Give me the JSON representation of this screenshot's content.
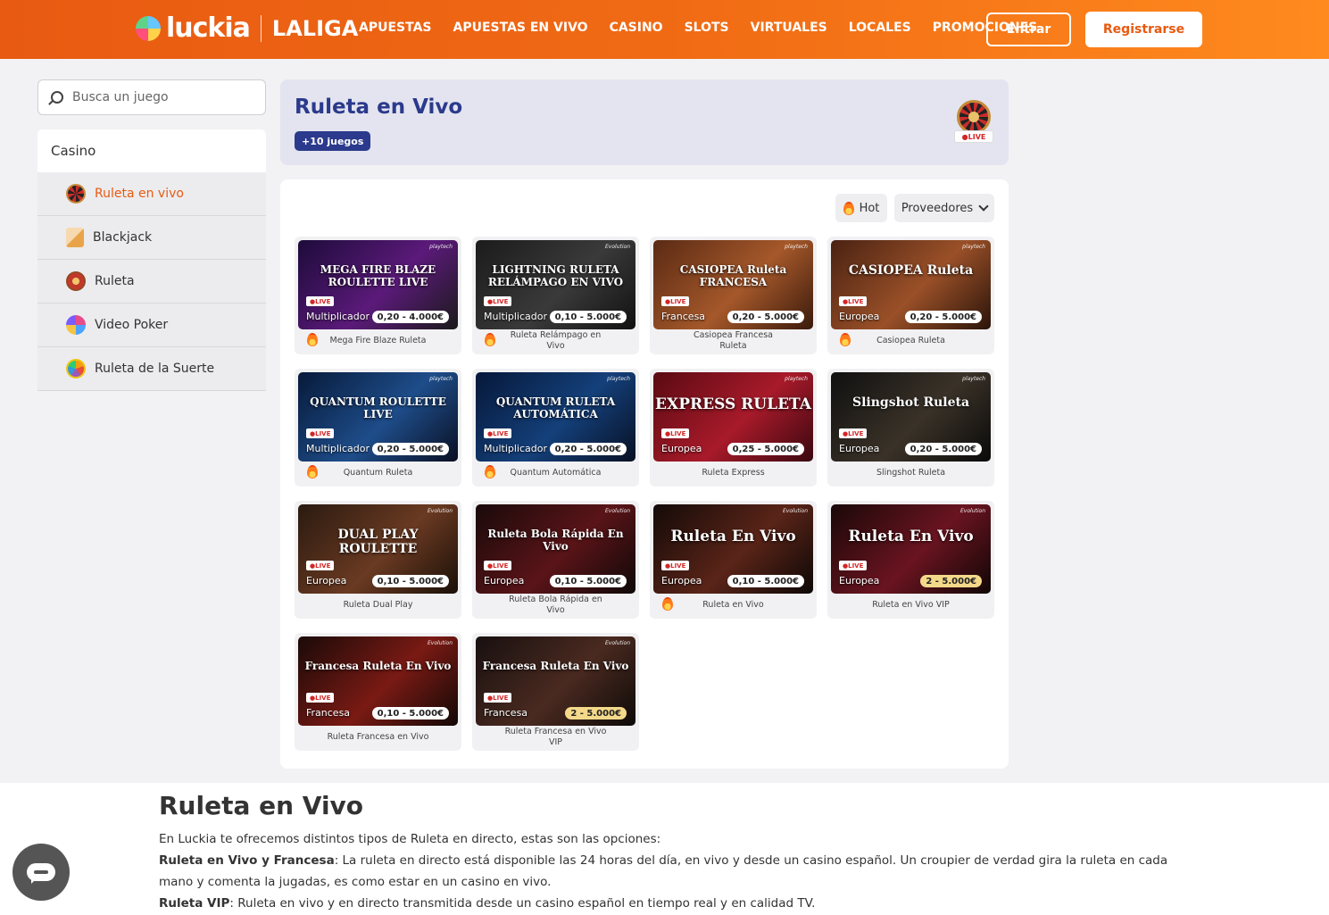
{
  "header": {
    "logo_text": "luckia",
    "logo_partner": "LALIGA",
    "nav": [
      "APUESTAS",
      "APUESTAS EN VIVO",
      "CASINO",
      "SLOTS",
      "VIRTUALES",
      "LOCALES",
      "PROMOCIONES"
    ],
    "login_label": "Entrar",
    "register_label": "Registrarse",
    "brand_color": "#e85a12"
  },
  "sidebar": {
    "search_placeholder": "Busca un juego",
    "section_title": "Casino",
    "items": [
      {
        "label": "Ruleta en vivo",
        "icon": "live-roulette-icon",
        "active": true
      },
      {
        "label": "Blackjack",
        "icon": "cards-icon",
        "active": false
      },
      {
        "label": "Ruleta",
        "icon": "roulette-icon",
        "active": false
      },
      {
        "label": "Video Poker",
        "icon": "poker-chip-icon",
        "active": false
      },
      {
        "label": "Ruleta de la Suerte",
        "icon": "fortune-wheel-icon",
        "active": false
      }
    ]
  },
  "hero": {
    "title": "Ruleta en Vivo",
    "badge": "+10 juegos",
    "icon_live": "LIVE",
    "title_color": "#2b3a8c"
  },
  "filters": {
    "hot_label": "Hot",
    "providers_label": "Proveedores"
  },
  "games": [
    {
      "name": "Mega Fire Blaze Ruleta",
      "thumb_title": "MEGA FIRE BLAZE ROULETTE LIVE",
      "variant": "Multiplicador",
      "range": "0,20 - 4.000€",
      "hot": true,
      "vip": false,
      "brand": "playtech",
      "live": "LIVE"
    },
    {
      "name": "Ruleta Relámpago en Vivo",
      "thumb_title": "LIGHTNING RULETA RELÁMPAGO EN VIVO",
      "variant": "Multiplicador",
      "range": "0,10 - 5.000€",
      "hot": true,
      "vip": false,
      "brand": "Evolution",
      "live": "LIVE"
    },
    {
      "name": "Casiopea Francesa Ruleta",
      "thumb_title": "CASIOPEA Ruleta FRANCESA",
      "variant": "Francesa",
      "range": "0,20 - 5.000€",
      "hot": false,
      "vip": false,
      "brand": "playtech",
      "live": "LIVE"
    },
    {
      "name": "Casiopea Ruleta",
      "thumb_title": "CASIOPEA Ruleta",
      "variant": "Europea",
      "range": "0,20 - 5.000€",
      "hot": true,
      "vip": false,
      "brand": "playtech",
      "live": "LIVE"
    },
    {
      "name": "Quantum Ruleta",
      "thumb_title": "QUANTUM ROULETTE LIVE",
      "variant": "Multiplicador",
      "range": "0,20 - 5.000€",
      "hot": true,
      "vip": false,
      "brand": "playtech",
      "live": "LIVE"
    },
    {
      "name": "Quantum Automática",
      "thumb_title": "QUANTUM RULETA AUTOMÁTICA",
      "variant": "Multiplicador",
      "range": "0,20 - 5.000€",
      "hot": true,
      "vip": false,
      "brand": "playtech",
      "live": "LIVE"
    },
    {
      "name": "Ruleta Express",
      "thumb_title": "EXPRESS RULETA",
      "variant": "Europea",
      "range": "0,25 - 5.000€",
      "hot": false,
      "vip": false,
      "brand": "playtech",
      "live": "LIVE"
    },
    {
      "name": "Slingshot Ruleta",
      "thumb_title": "Slingshot Ruleta",
      "variant": "Europea",
      "range": "0,20 - 5.000€",
      "hot": false,
      "vip": false,
      "brand": "playtech",
      "live": "LIVE"
    },
    {
      "name": "Ruleta Dual Play",
      "thumb_title": "DUAL PLAY ROULETTE",
      "variant": "Europea",
      "range": "0,10 - 5.000€",
      "hot": false,
      "vip": false,
      "brand": "Evolution",
      "live": "LIVE"
    },
    {
      "name": "Ruleta Bola Rápida en Vivo",
      "thumb_title": "Ruleta Bola Rápida En Vivo",
      "variant": "Europea",
      "range": "0,10 - 5.000€",
      "hot": false,
      "vip": false,
      "brand": "Evolution",
      "live": "LIVE"
    },
    {
      "name": "Ruleta en Vivo",
      "thumb_title": "Ruleta En Vivo",
      "variant": "Europea",
      "range": "0,10 - 5.000€",
      "hot": true,
      "vip": false,
      "brand": "Evolution",
      "live": "LIVE"
    },
    {
      "name": "Ruleta en Vivo VIP",
      "thumb_title": "Ruleta En Vivo",
      "variant": "Europea",
      "range": "2 - 5.000€",
      "hot": false,
      "vip": true,
      "brand": "Evolution",
      "live": "LIVE"
    },
    {
      "name": "Ruleta Francesa en Vivo",
      "thumb_title": "Francesa Ruleta En Vivo",
      "variant": "Francesa",
      "range": "0,10 - 5.000€",
      "hot": false,
      "vip": false,
      "brand": "Evolution",
      "live": "LIVE"
    },
    {
      "name": "Ruleta Francesa en Vivo VIP",
      "thumb_title": "Francesa Ruleta En Vivo",
      "variant": "Francesa",
      "range": "2 - 5.000€",
      "hot": false,
      "vip": true,
      "brand": "Evolution",
      "live": "LIVE"
    }
  ],
  "seo": {
    "title": "Ruleta en Vivo",
    "intro": "En Luckia te ofrecemos distintos tipos de Ruleta en directo, estas son las opciones:",
    "p1_bold": "Ruleta en Vivo y Francesa",
    "p1_text": ": La ruleta en directo está disponible las 24 horas del día, en vivo y desde un casino español. Un croupier de verdad gira la ruleta en cada mano y comenta la jugadas, es como estar en un casino en vivo.",
    "p2_bold": "Ruleta VIP",
    "p2_text": ": Ruleta en vivo y en directo transmitida desde un casino español en tiempo real y en calidad TV."
  }
}
